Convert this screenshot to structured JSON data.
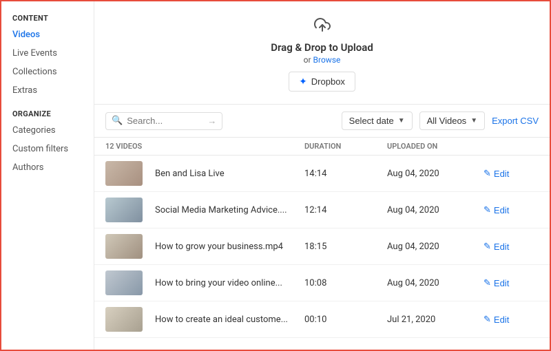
{
  "sidebar": {
    "content_label": "CONTENT",
    "organize_label": "ORGANIZE",
    "items_content": [
      {
        "label": "Videos",
        "active": true
      },
      {
        "label": "Live Events",
        "active": false
      },
      {
        "label": "Collections",
        "active": false
      },
      {
        "label": "Extras",
        "active": false
      }
    ],
    "items_organize": [
      {
        "label": "Categories",
        "active": false
      },
      {
        "label": "Custom filters",
        "active": false
      },
      {
        "label": "Authors",
        "active": false
      }
    ]
  },
  "upload": {
    "title": "Drag & Drop to Upload",
    "or_text": "or",
    "browse_label": "Browse",
    "dropbox_label": "Dropbox"
  },
  "toolbar": {
    "search_placeholder": "Search...",
    "select_date_label": "Select date",
    "all_videos_label": "All Videos",
    "export_csv_label": "Export CSV"
  },
  "table": {
    "count_label": "12 VIDEOS",
    "col_duration": "DURATION",
    "col_uploaded": "UPLOADED ON",
    "col_action": "",
    "rows": [
      {
        "title": "Ben and Lisa Live",
        "duration": "14:14",
        "uploaded": "Aug 04, 2020",
        "thumb": "1"
      },
      {
        "title": "Social Media Marketing Advice....",
        "duration": "12:14",
        "uploaded": "Aug 04, 2020",
        "thumb": "2"
      },
      {
        "title": "How to grow your business.mp4",
        "duration": "18:15",
        "uploaded": "Aug 04, 2020",
        "thumb": "3"
      },
      {
        "title": "How to bring your video online...",
        "duration": "10:08",
        "uploaded": "Aug 04, 2020",
        "thumb": "4"
      },
      {
        "title": "How to create an ideal custome...",
        "duration": "00:10",
        "uploaded": "Jul 21, 2020",
        "thumb": "5"
      }
    ],
    "edit_label": "Edit"
  }
}
